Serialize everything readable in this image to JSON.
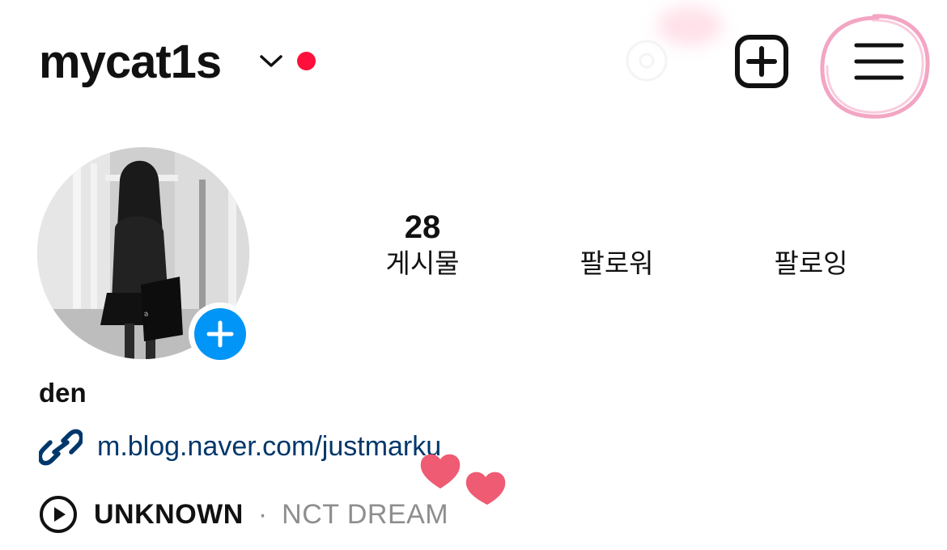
{
  "header": {
    "username": "mycat1s",
    "account_switcher_icon": "chevron-down-icon",
    "notification_dot_color": "#ff0f3b",
    "new_post_icon": "plus-square-icon",
    "menu_icon": "hamburger-menu-icon",
    "annotation_color": "#f29bbd"
  },
  "profile": {
    "avatar_icon": "profile-photo",
    "add_story_icon": "plus-circle-icon",
    "add_story_color": "#0095f6",
    "stats": [
      {
        "value": "28",
        "label": "게시물"
      },
      {
        "value": "",
        "label": "팔로워"
      },
      {
        "value": "",
        "label": "팔로잉"
      }
    ]
  },
  "bio": {
    "display_name": "den",
    "link_icon": "link-icon",
    "link": "m.blog.naver.com/justmarku",
    "link_color": "#00376b",
    "sticker": "hearts-sticker",
    "music": {
      "icon": "play-circle-icon",
      "song": "UNKNOWN",
      "separator": "·",
      "artist": "NCT DREAM"
    }
  }
}
